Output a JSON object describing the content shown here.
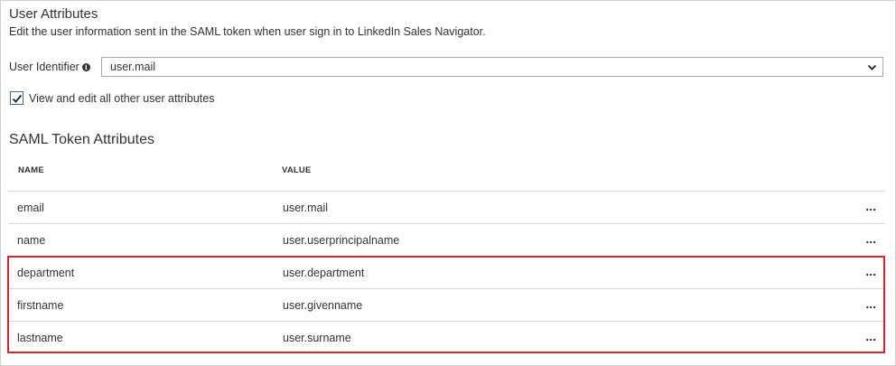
{
  "section": {
    "title": "User Attributes",
    "subtitle": "Edit the user information sent in the SAML token when user sign in to LinkedIn Sales Navigator."
  },
  "user_identifier": {
    "label": "User Identifier",
    "info_icon": "info-icon",
    "value": "user.mail",
    "dropdown_icon": "chevron-down-icon"
  },
  "checkbox": {
    "label": "View and edit all other user attributes",
    "checked": true
  },
  "saml": {
    "title": "SAML Token Attributes",
    "headers": {
      "name": "NAME",
      "value": "VALUE"
    },
    "rows": [
      {
        "name": "email",
        "value": "user.mail",
        "more": "..."
      },
      {
        "name": "name",
        "value": "user.userprincipalname",
        "more": "..."
      },
      {
        "name": "department",
        "value": "user.department",
        "more": "..."
      },
      {
        "name": "firstname",
        "value": "user.givenname",
        "more": "..."
      },
      {
        "name": "lastname",
        "value": "user.surname",
        "more": "..."
      }
    ]
  },
  "colors": {
    "highlight": "#d9232d",
    "checkbox_border": "#3a6fa8",
    "text": "#333333"
  }
}
